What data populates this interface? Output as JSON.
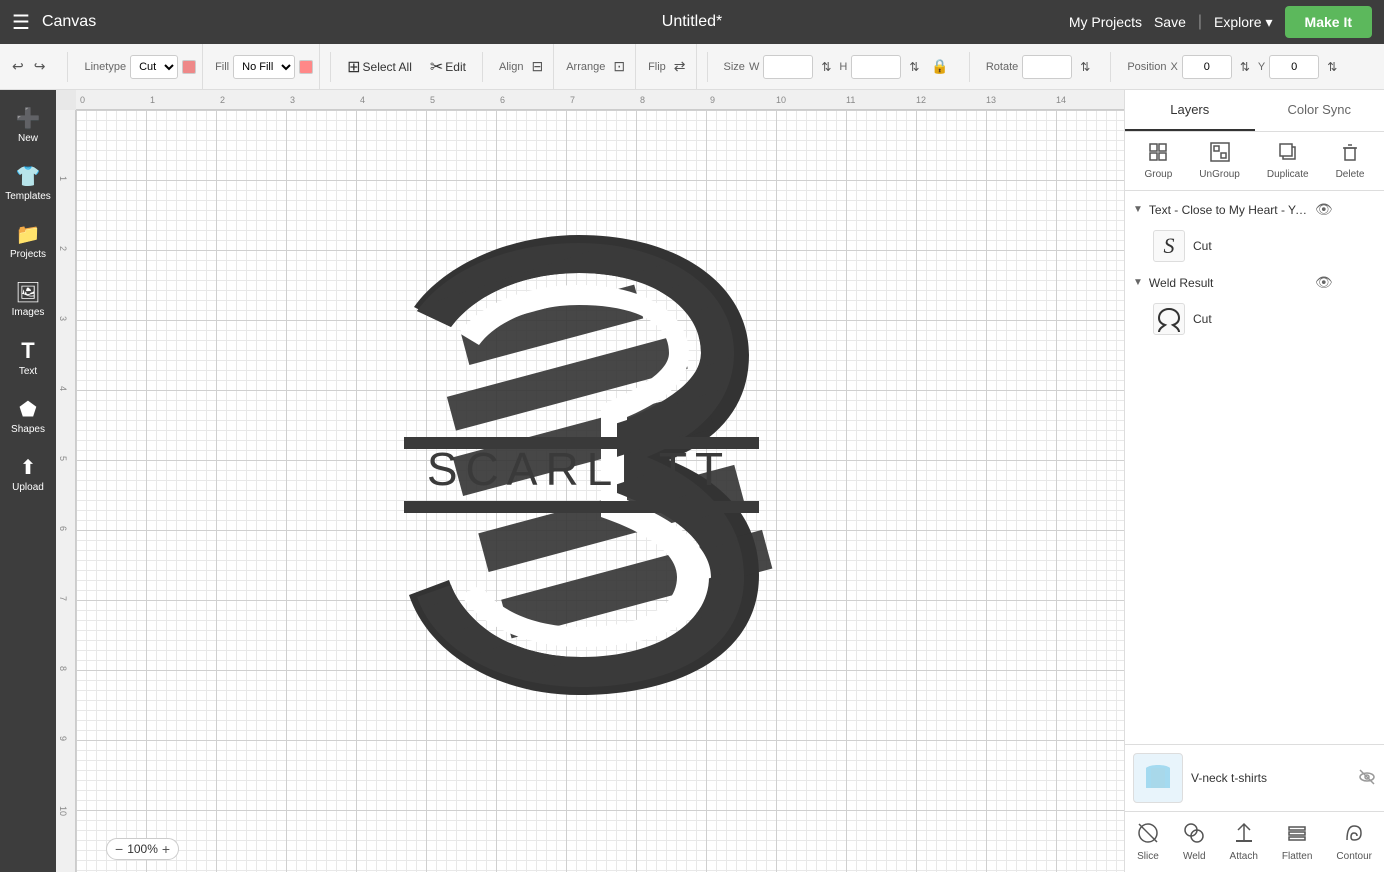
{
  "topNav": {
    "hamburger": "☰",
    "appName": "Canvas",
    "title": "Untitled*",
    "myProjects": "My Projects",
    "save": "Save",
    "explore": "Explore",
    "makeIt": "Make It"
  },
  "toolbar": {
    "undo": "↩",
    "redo": "↪",
    "linetypeLabel": "Linetype",
    "linetypeValue": "Cut",
    "fillLabel": "Fill",
    "fillValue": "No Fill",
    "selectAll": "Select All",
    "edit": "Edit",
    "alignLabel": "Align",
    "arrangeLabel": "Arrange",
    "flipLabel": "Flip",
    "sizeLabel": "Size",
    "wLabel": "W",
    "hLabel": "H",
    "lockIcon": "🔒",
    "rotateLabel": "Rotate",
    "positionLabel": "Position",
    "xLabel": "X",
    "xValue": "0",
    "yLabel": "Y",
    "yValue": "0"
  },
  "sidebar": {
    "items": [
      {
        "icon": "➕",
        "label": "New"
      },
      {
        "icon": "👕",
        "label": "Templates"
      },
      {
        "icon": "📁",
        "label": "Projects"
      },
      {
        "icon": "🖼",
        "label": "Images"
      },
      {
        "icon": "T",
        "label": "Text"
      },
      {
        "icon": "⬟",
        "label": "Shapes"
      },
      {
        "icon": "⬆",
        "label": "Upload"
      }
    ]
  },
  "canvas": {
    "zoom": "100%",
    "rulerTicks": [
      "0",
      "1",
      "2",
      "3",
      "4",
      "5",
      "6",
      "7",
      "8",
      "9",
      "10",
      "11",
      "12",
      "13",
      "14"
    ]
  },
  "rightPanel": {
    "tabs": [
      "Layers",
      "Color Sync"
    ],
    "activeTab": "Layers",
    "layerActions": [
      {
        "icon": "⬡",
        "label": "Group"
      },
      {
        "icon": "⬡",
        "label": "UnGroup"
      },
      {
        "icon": "⬡",
        "label": "Duplicate"
      },
      {
        "icon": "🗑",
        "label": "Delete"
      }
    ],
    "layers": [
      {
        "type": "group",
        "name": "Text - Close to My Heart - You...",
        "visible": true,
        "items": [
          {
            "thumbnail": "S",
            "label": "Cut"
          }
        ]
      },
      {
        "type": "group",
        "name": "Weld Result",
        "visible": true,
        "items": [
          {
            "thumbnail": "✦",
            "label": "Cut"
          }
        ]
      }
    ],
    "bottomPreview": {
      "label": "V-neck t-shirts",
      "visible": false
    },
    "bottomActions": [
      {
        "icon": "✂",
        "label": "Slice"
      },
      {
        "icon": "⊕",
        "label": "Weld"
      },
      {
        "icon": "📎",
        "label": "Attach"
      },
      {
        "icon": "⬡",
        "label": "Flatten"
      },
      {
        "icon": "⬡",
        "label": "Contour"
      }
    ]
  }
}
